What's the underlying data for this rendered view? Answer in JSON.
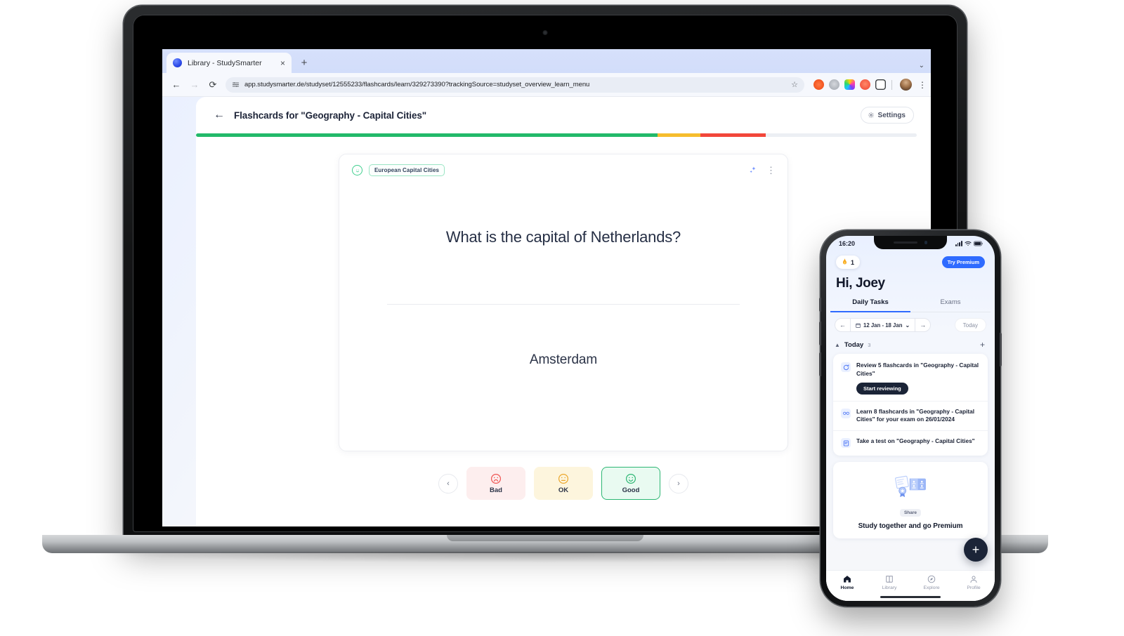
{
  "browser": {
    "tab_title": "Library - StudySmarter",
    "tab_close": "×",
    "new_tab": "+",
    "tab_list_chevron": "⌄",
    "back": "←",
    "forward": "→",
    "reload": "⟳",
    "url": "app.studysmarter.de/studyset/12555233/flashcards/learn/329273390?trackingSource=studyset_overview_learn_menu",
    "star": "☆",
    "menu": "⋮",
    "extensions": [
      {
        "name": "extension-orange-icon",
        "color": "#f2541f"
      },
      {
        "name": "extension-gray-icon",
        "color": "#b4b8bf"
      },
      {
        "name": "extension-rainbow-icon",
        "color": "#d63ad6"
      },
      {
        "name": "extension-coral-icon",
        "color": "#f45c43"
      },
      {
        "name": "extension-outline-icon",
        "color": "#ffffff"
      }
    ]
  },
  "web_app": {
    "back_arrow": "←",
    "page_title": "Flashcards for \"Geography - Capital Cities\"",
    "settings_label": "Settings",
    "settings_icon": "gear-icon",
    "progress": {
      "green_pct": 64,
      "yellow_pct": 6,
      "red_pct": 9,
      "track_color": "#eceff4",
      "green": "#22b96a",
      "yellow": "#f6bd2e",
      "red": "#f2463a"
    },
    "card": {
      "face_icon": "smiley-face-icon",
      "tag": "European Capital Cities",
      "ai_icon": "ai-sparkle-icon",
      "menu_icon": "kebab-menu-icon",
      "question": "What is the capital of Netherlands?",
      "answer": "Amsterdam"
    },
    "controls": {
      "prev": "‹",
      "next": "›",
      "ratings": [
        {
          "label": "Bad",
          "icon": "frown-face-icon",
          "color": "#ef5350",
          "bg": "#fdeeee"
        },
        {
          "label": "OK",
          "icon": "neutral-face-icon",
          "color": "#eca72c",
          "bg": "#fdf5dd"
        },
        {
          "label": "Good",
          "icon": "smile-face-icon",
          "color": "#2cb673",
          "bg": "#e9faf1"
        }
      ]
    }
  },
  "phone_app": {
    "status": {
      "time": "16:20",
      "signal_icon": "cellular-signal-icon",
      "wifi_icon": "wifi-icon",
      "battery_icon": "battery-icon"
    },
    "streak": {
      "icon": "flame-icon",
      "count": "1"
    },
    "premium_button": "Try Premium",
    "greeting": "Hi, Joey",
    "tabs": [
      {
        "label": "Daily Tasks",
        "active": true
      },
      {
        "label": "Exams",
        "active": false
      }
    ],
    "date_nav": {
      "prev": "←",
      "next": "→",
      "calendar_icon": "calendar-icon",
      "range": "12 Jan - 18 Jan",
      "chevron": "⌄",
      "today_button": "Today"
    },
    "section": {
      "collapse_icon": "chevron-up-icon",
      "label": "Today",
      "count": "3",
      "add_icon": "plus-icon"
    },
    "tasks": [
      {
        "icon": "refresh-icon",
        "text": "Review 5 flashcards in \"Geography - Capital Cities\"",
        "action": "Start reviewing"
      },
      {
        "icon": "glasses-icon",
        "text": "Learn 8 flashcards in \"Geography - Capital Cities\" for your exam on 26/01/2024",
        "action": ""
      },
      {
        "icon": "test-icon",
        "text": "Take a test on \"Geography - Capital Cities\"",
        "action": ""
      }
    ],
    "promo": {
      "illustration": "certificate-and-cards-icon",
      "badge": "Share",
      "title": "Study together and go Premium"
    },
    "fab": "+",
    "nav": [
      {
        "label": "Home",
        "icon": "home-icon",
        "active": true
      },
      {
        "label": "Library",
        "icon": "book-icon",
        "active": false
      },
      {
        "label": "Explore",
        "icon": "compass-icon",
        "active": false
      },
      {
        "label": "Profile",
        "icon": "person-icon",
        "active": false
      }
    ]
  }
}
